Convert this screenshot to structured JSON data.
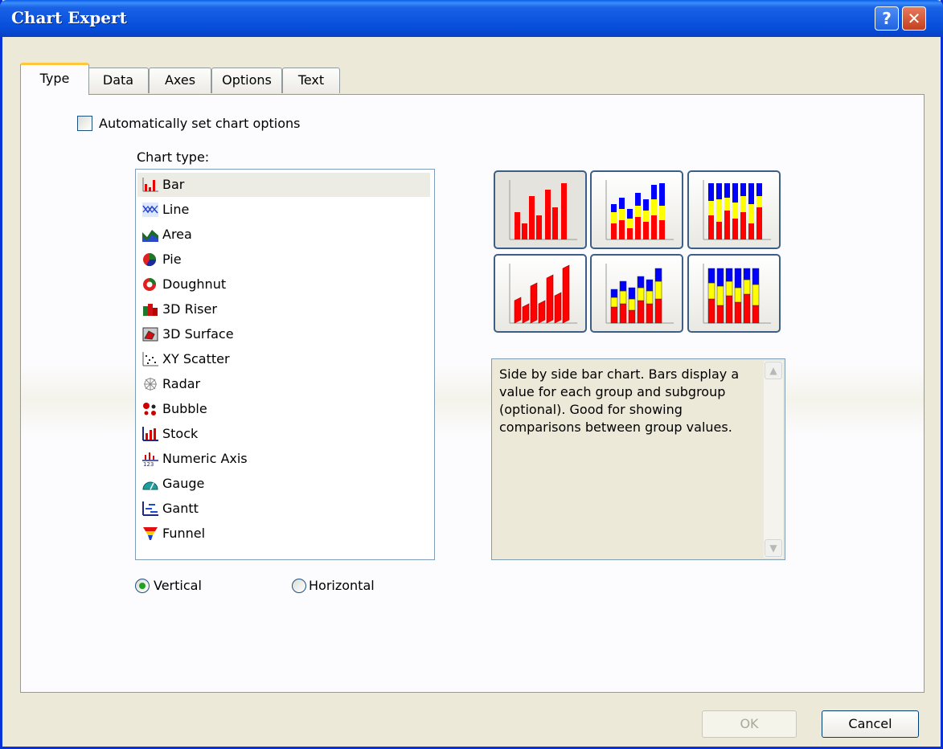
{
  "window": {
    "title": "Chart Expert"
  },
  "titlebar": {
    "help_glyph": "?",
    "close_glyph": "✕"
  },
  "tabs": [
    {
      "label": "Type",
      "active": true
    },
    {
      "label": "Data"
    },
    {
      "label": "Axes"
    },
    {
      "label": "Options"
    },
    {
      "label": "Text"
    }
  ],
  "auto_options": {
    "label": "Automatically set chart options",
    "checked": false
  },
  "chart_type": {
    "heading": "Chart type:",
    "items": [
      {
        "label": "Bar",
        "icon": "bar-chart-icon",
        "selected": true
      },
      {
        "label": "Line",
        "icon": "line-chart-icon"
      },
      {
        "label": "Area",
        "icon": "area-chart-icon"
      },
      {
        "label": "Pie",
        "icon": "pie-chart-icon"
      },
      {
        "label": "Doughnut",
        "icon": "doughnut-chart-icon"
      },
      {
        "label": "3D Riser",
        "icon": "3d-riser-icon"
      },
      {
        "label": "3D Surface",
        "icon": "3d-surface-icon"
      },
      {
        "label": "XY Scatter",
        "icon": "xy-scatter-icon"
      },
      {
        "label": "Radar",
        "icon": "radar-icon"
      },
      {
        "label": "Bubble",
        "icon": "bubble-icon"
      },
      {
        "label": "Stock",
        "icon": "stock-icon"
      },
      {
        "label": "Numeric Axis",
        "icon": "numeric-axis-icon"
      },
      {
        "label": "Gauge",
        "icon": "gauge-icon"
      },
      {
        "label": "Gantt",
        "icon": "gantt-icon"
      },
      {
        "label": "Funnel",
        "icon": "funnel-icon"
      }
    ]
  },
  "subtypes": [
    {
      "name": "side-by-side-bar",
      "selected": true
    },
    {
      "name": "stacked-bar"
    },
    {
      "name": "percent-stacked-bar"
    },
    {
      "name": "3d-side-by-side-bar"
    },
    {
      "name": "3d-stacked-bar"
    },
    {
      "name": "3d-percent-stacked-bar"
    }
  ],
  "description": "Side by side bar chart. Bars display a value for each group and subgroup (optional). Good for showing comparisons between group values.",
  "orientation": {
    "vertical": "Vertical",
    "horizontal": "Horizontal",
    "selected": "Vertical"
  },
  "buttons": {
    "ok": "OK",
    "cancel": "Cancel"
  },
  "colors": {
    "titlebar": "#0a53de",
    "bar_red": "#ff0000",
    "bar_yellow": "#ffff00",
    "bar_blue": "#0000ff"
  }
}
